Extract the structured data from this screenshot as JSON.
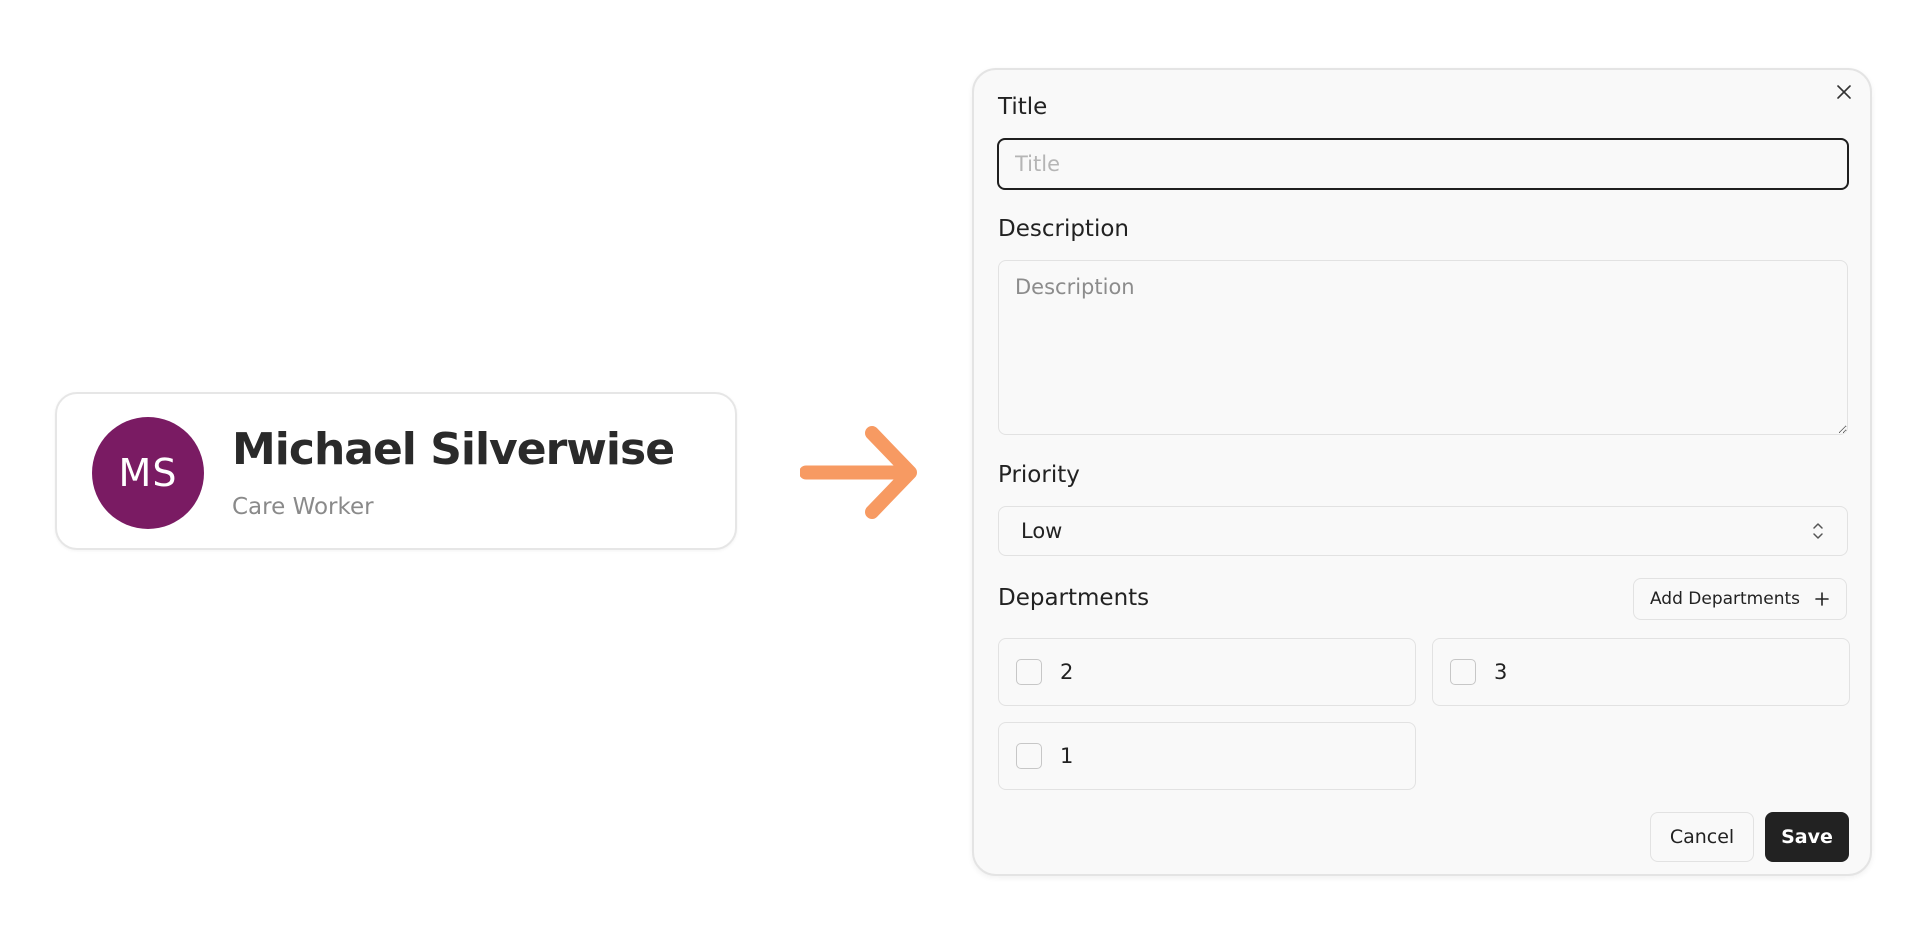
{
  "profile": {
    "initials": "MS",
    "name": "Michael Silverwise",
    "role": "Care Worker",
    "avatar_color": "#7a1b63"
  },
  "arrow": {
    "icon": "arrow-right-icon",
    "color": "#f79a62"
  },
  "dialog": {
    "close_icon": "close-icon",
    "title_label": "Title",
    "title_value": "",
    "title_placeholder": "Title",
    "description_label": "Description",
    "description_value": "",
    "description_placeholder": "Description",
    "priority_label": "Priority",
    "priority_value": "Low",
    "priority_icon": "chevron-up-down-icon",
    "departments_label": "Departments",
    "add_departments_label": "Add Departments",
    "add_departments_icon": "plus-icon",
    "departments": [
      {
        "label": "2",
        "checked": false
      },
      {
        "label": "3",
        "checked": false
      },
      {
        "label": "1",
        "checked": false
      }
    ],
    "cancel_label": "Cancel",
    "save_label": "Save"
  }
}
